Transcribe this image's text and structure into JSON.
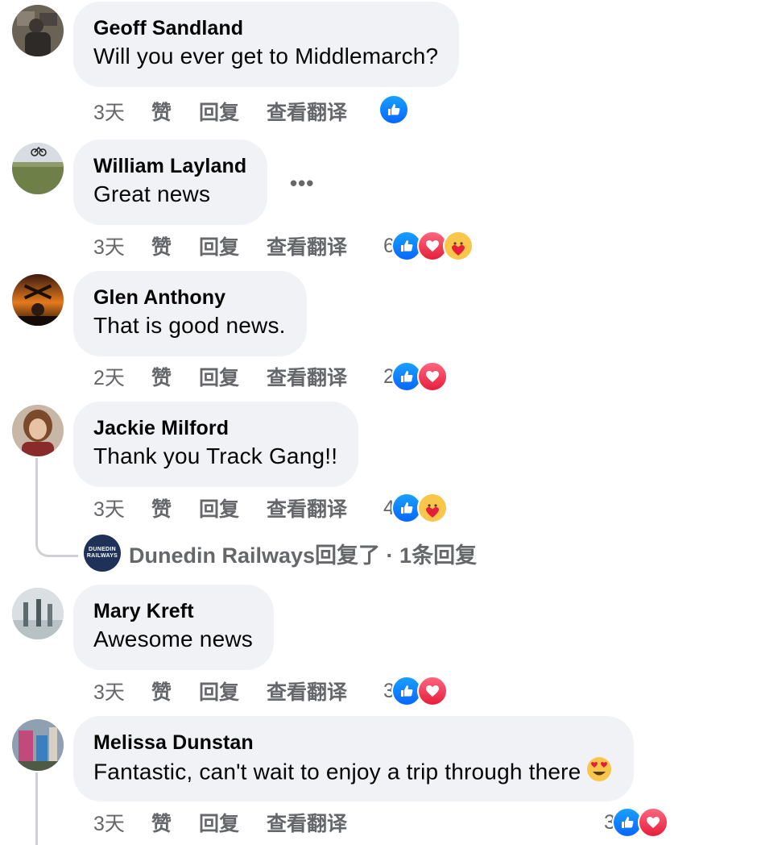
{
  "comments": [
    {
      "name": "Geoff Sandland",
      "text": "Will you ever get to Middlemarch?",
      "time": "3天",
      "like_label": "赞",
      "reply_label": "回复",
      "translate_label": "查看翻译",
      "reaction_count": "",
      "reactions": [
        "like-icon"
      ]
    },
    {
      "name": "William Layland",
      "text": "Great news",
      "time": "3天",
      "like_label": "赞",
      "reply_label": "回复",
      "translate_label": "查看翻译",
      "reaction_count": "6",
      "reactions": [
        "like-icon",
        "love-icon",
        "care-icon"
      ],
      "more_label": "•••"
    },
    {
      "name": "Glen Anthony",
      "text": "That is good news.",
      "time": "2天",
      "like_label": "赞",
      "reply_label": "回复",
      "translate_label": "查看翻译",
      "reaction_count": "2",
      "reactions": [
        "like-icon",
        "love-icon"
      ]
    },
    {
      "name": "Jackie Milford",
      "text": "Thank you Track Gang!!",
      "time": "3天",
      "like_label": "赞",
      "reply_label": "回复",
      "translate_label": "查看翻译",
      "reaction_count": "4",
      "reactions": [
        "like-icon",
        "care-icon"
      ],
      "replies": {
        "page_avatar_line1": "DUNEDIN",
        "page_avatar_line2": "RAILWAYS",
        "text": "Dunedin Railways回复了 · 1条回复"
      }
    },
    {
      "name": "Mary Kreft",
      "text": "Awesome news",
      "time": "3天",
      "like_label": "赞",
      "reply_label": "回复",
      "translate_label": "查看翻译",
      "reaction_count": "3",
      "reactions": [
        "like-icon",
        "love-icon"
      ]
    },
    {
      "name": "Melissa Dunstan",
      "text": "Fantastic, can't wait to enjoy a trip through there",
      "text_emoji": "heart-eyes-emoji",
      "time": "3天",
      "like_label": "赞",
      "reply_label": "回复",
      "translate_label": "查看翻译",
      "reaction_count": "3",
      "reactions": [
        "like-icon",
        "love-icon"
      ]
    }
  ],
  "colors": {
    "bubble": "#f0f2f5",
    "meta_text": "#65676b",
    "like_blue": "#0866ff",
    "love_red": "#e61e3c",
    "care_yellow": "#f7c64a",
    "thread_line": "#ced0d4"
  }
}
